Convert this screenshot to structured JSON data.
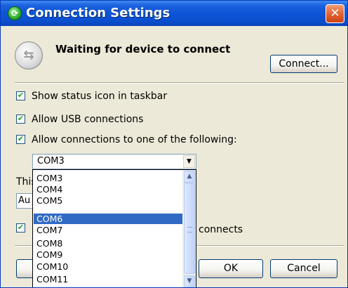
{
  "window": {
    "title": "Connection Settings",
    "title_icon": "green-circle-icon",
    "close_icon": "close-x-icon",
    "title_icon_glyph": "⟳",
    "close_glyph": "✕"
  },
  "status": {
    "icon": "sync-arrows-icon",
    "icon_glyph": "⇆",
    "text": "Waiting for device to connect"
  },
  "buttons": {
    "connect": "Connect...",
    "ok": "OK",
    "cancel": "Cancel"
  },
  "options": [
    {
      "label": "Show status icon in taskbar",
      "checked": true
    },
    {
      "label": "Allow USB connections",
      "checked": true
    },
    {
      "label": "Allow connections to one of the following:",
      "checked": true
    }
  ],
  "check_glyph": "✔",
  "port_select": {
    "value": "COM3",
    "arrow_glyph": "▼",
    "options": [
      "COM3",
      "COM4",
      "COM5",
      "COM6",
      "COM7",
      "COM8",
      "COM9",
      "COM10",
      "COM11"
    ],
    "highlighted": "COM6"
  },
  "scroll": {
    "up_glyph": "▲",
    "down_glyph": "▼"
  },
  "partially_hidden": {
    "label_fragment": "This",
    "field_fragment": "Au",
    "trailing_text": "connects"
  },
  "colors": {
    "titlebar": "#0b4fcf",
    "selection": "#316ac5",
    "close_button": "#e35f2f"
  }
}
